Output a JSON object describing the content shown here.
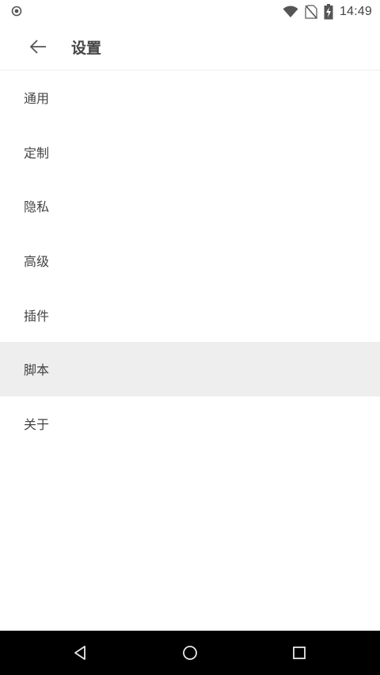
{
  "status_bar": {
    "time": "14:49",
    "icons": [
      "record-icon",
      "wifi-icon",
      "no-sim-icon",
      "battery-charging-icon"
    ]
  },
  "app_bar": {
    "title": "设置",
    "back_icon": "arrow-left-icon"
  },
  "menu": {
    "items": [
      {
        "label": "通用",
        "active": false
      },
      {
        "label": "定制",
        "active": false
      },
      {
        "label": "隐私",
        "active": false
      },
      {
        "label": "高级",
        "active": false
      },
      {
        "label": "插件",
        "active": false
      },
      {
        "label": "脚本",
        "active": true
      },
      {
        "label": "关于",
        "active": false
      }
    ]
  },
  "nav_bar": {
    "icons": [
      "back-triangle-icon",
      "home-circle-icon",
      "recents-square-icon"
    ]
  },
  "colors": {
    "active_row": "#eeeeee",
    "text": "#444444",
    "nav_bar": "#000000"
  }
}
